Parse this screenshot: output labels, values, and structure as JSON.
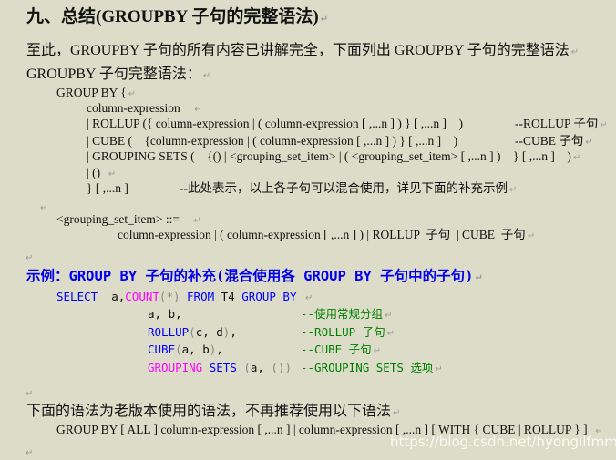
{
  "heading": "九、总结(GROUPBY 子句的完整语法)",
  "intro": {
    "line1": "至此，GROUPBY 子句的所有内容已讲解完全，下面列出 GROUPBY 子句的完整语法",
    "line2": "GROUPBY 子句完整语法："
  },
  "syntax": {
    "l1": "GROUP BY {",
    "l2": "column-expression",
    "l3": "| ROLLUP ({ column-expression | ( column-expression [ ,...n ] ) } [ ,...n ]    )",
    "l3_comment": "--ROLLUP 子句",
    "l4": "| CUBE (    {column-expression | ( column-expression [ ,...n ] ) } [ ,...n ]    )",
    "l4_comment": "--CUBE 子句",
    "l5": "| GROUPING SETS (    {() | <grouping_set_item> | ( <grouping_set_item> [ ,...n ] )    } [ ,...n ]    )",
    "l6": "| ()",
    "l7": "} [ ,...n ]",
    "l7_comment": "--此处表示，以上各子句可以混合使用，详见下面的补充示例",
    "item_def": "<grouping_set_item> ::=",
    "item_body": "column-expression | ( column-expression [ ,...n ] ) | ROLLUP  子句  | CUBE  子句"
  },
  "example": {
    "title": "示例：GROUP BY 子句的补充(混合使用各 GROUP BY 子句中的子句)",
    "select_kw": "SELECT",
    "select_col": "a,",
    "count_fn": "COUNT",
    "count_arg": "(*)",
    "from_kw": "FROM",
    "table": "T4",
    "groupby_kw": "GROUP BY",
    "rows": [
      {
        "parts": [
          {
            "t": "a, b,",
            "c": "black"
          }
        ],
        "comment": "--使用常规分组"
      },
      {
        "parts": [
          {
            "t": "ROLLUP",
            "c": "blue"
          },
          {
            "t": "(",
            "c": "gray"
          },
          {
            "t": "c, d",
            "c": "black"
          },
          {
            "t": ")",
            "c": "gray"
          },
          {
            "t": ",",
            "c": "black"
          }
        ],
        "comment": "--ROLLUP 子句"
      },
      {
        "parts": [
          {
            "t": "CUBE",
            "c": "blue"
          },
          {
            "t": "(",
            "c": "gray"
          },
          {
            "t": "a, b",
            "c": "black"
          },
          {
            "t": ")",
            "c": "gray"
          },
          {
            "t": ",",
            "c": "black"
          }
        ],
        "comment": "--CUBE 子句"
      },
      {
        "parts": [
          {
            "t": "GROUPING",
            "c": "pink"
          },
          {
            "t": " SETS ",
            "c": "blue"
          },
          {
            "t": "(",
            "c": "gray"
          },
          {
            "t": "a, ",
            "c": "black"
          },
          {
            "t": "()",
            "c": "gray"
          },
          {
            "t": ")",
            "c": "gray"
          }
        ],
        "comment": "--GROUPING SETS 选项"
      }
    ]
  },
  "legacy": {
    "intro": "下面的语法为老版本使用的语法，不再推荐使用以下语法",
    "syntax": "GROUP BY [ ALL ] column-expression [ ,...n ] | column-expression [ ,...n ] [ WITH { CUBE | ROLLUP } ]"
  },
  "watermark": "https://blog.csdn.net/hyongilfmmm",
  "paragraph_mark": "↵"
}
